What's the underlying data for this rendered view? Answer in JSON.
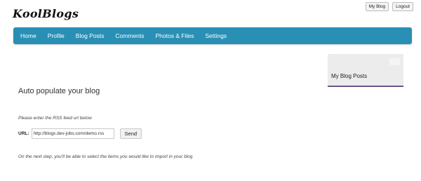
{
  "header": {
    "logo_text": "KoolBlogs",
    "top_links": [
      "My Blog",
      "Logout"
    ]
  },
  "nav": {
    "items": [
      "Home",
      "Profile",
      "Blog Posts",
      "Comments",
      "Photos & Files",
      "Settings"
    ],
    "color": "#2a8fb5"
  },
  "sidebar": {
    "widget_title": "My Blog Posts",
    "accent_color": "#6d5486"
  },
  "main": {
    "title": "Auto populate your blog",
    "instruction": "Please enter the RSS feed url below",
    "url_label": "URL:",
    "url_value": "http://blogs.dev-jobs.com/demo.rss",
    "send_label": "Send",
    "note": "On the next step, you'll be able to select the items you would like to import in your blog"
  }
}
